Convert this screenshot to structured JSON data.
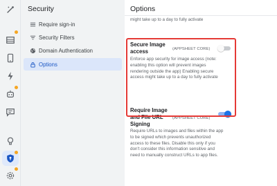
{
  "rail": {
    "icons": [
      "magic-wand-icon",
      "table-icon",
      "phone-icon",
      "lightning-icon",
      "robot-icon",
      "chat-icon",
      "lightbulb-icon",
      "shield-icon",
      "gear-icon"
    ]
  },
  "nav": {
    "title": "Security",
    "items": [
      {
        "label": "Require sign-in",
        "icon": "list-icon"
      },
      {
        "label": "Security Filters",
        "icon": "filter-icon"
      },
      {
        "label": "Domain Authentication",
        "icon": "globe-icon"
      },
      {
        "label": "Options",
        "icon": "lock-icon",
        "active": true
      }
    ]
  },
  "main": {
    "title": "Options",
    "prev_desc": "might take up to a day to fully activate",
    "settings": [
      {
        "title_lines": [
          "Secure Image",
          "access"
        ],
        "tag": "(APPSHEET CORE)",
        "description": "Enforce app security for image access (note: enabling this option will prevent images rendering outside the app) Enabling secure access might take up to a day to fully activate",
        "enabled": false
      },
      {
        "title_lines": [
          "Require Image",
          "and File URL",
          "Signing"
        ],
        "tag": "(APPSHEET CORE)",
        "description": "Require URLs to images and files within the app to be signed which prevents unauthorized access to these files. Disable this only if you don't consider this information sensitive and need to manually construct URLs to app files.",
        "enabled": true
      }
    ]
  },
  "colors": {
    "accent": "#1a73e8",
    "highlight_border": "#e53935",
    "badge": "#f5a623"
  }
}
